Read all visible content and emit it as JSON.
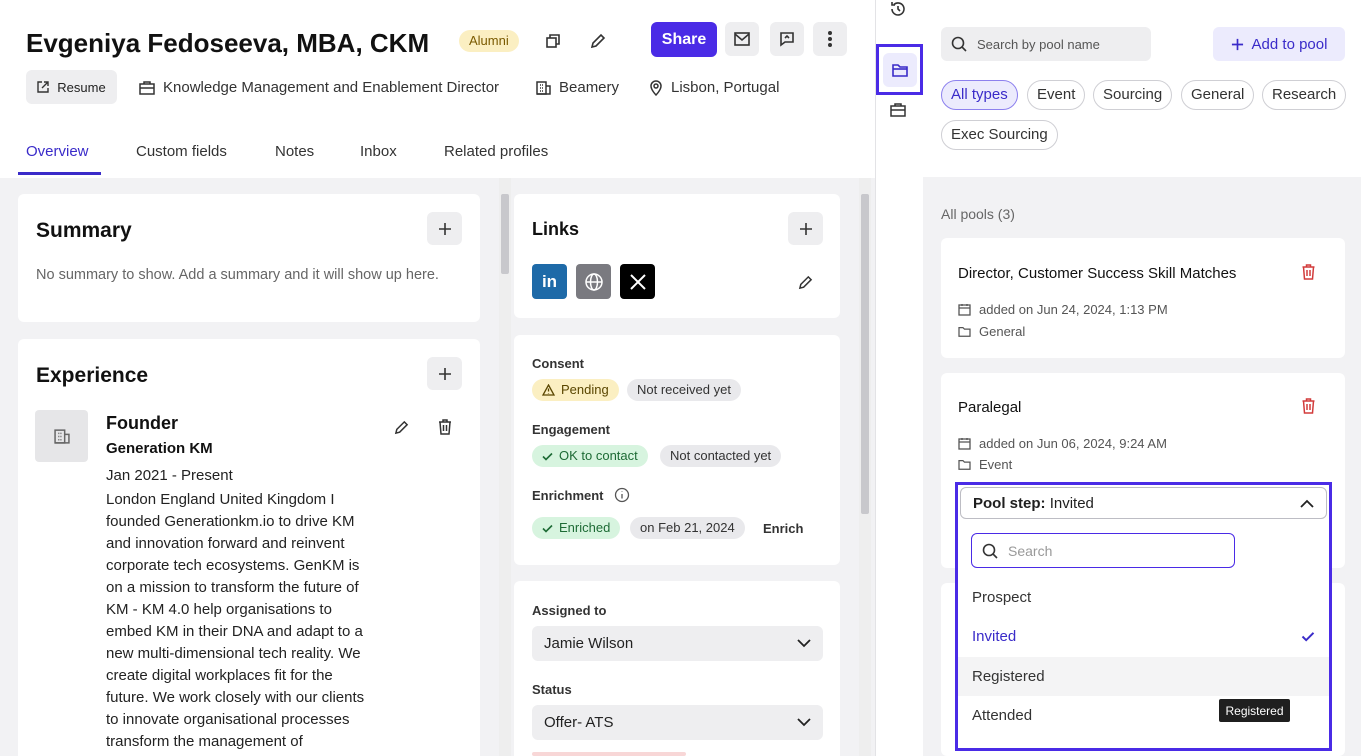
{
  "header": {
    "name": "Evgeniya Fedoseeva, MBA, CKM",
    "badge": "Alumni",
    "share_label": "Share",
    "resume_label": "Resume",
    "job_title": "Knowledge Management and Enablement Director",
    "company": "Beamery",
    "location": "Lisbon, Portugal"
  },
  "tabs": [
    {
      "label": "Overview",
      "active": true
    },
    {
      "label": "Custom fields"
    },
    {
      "label": "Notes"
    },
    {
      "label": "Inbox"
    },
    {
      "label": "Related profiles"
    }
  ],
  "summary": {
    "title": "Summary",
    "empty_text": "No summary to show. Add a summary and it will show up here."
  },
  "experience": {
    "title": "Experience",
    "role": "Founder",
    "company": "Generation KM",
    "dates": "Jan 2021 - Present",
    "description": "London England United Kingdom I founded Generationkm.io to drive KM and innovation forward and reinvent corporate tech ecosystems. GenKM is on a mission to transform the future of KM - KM 4.0 help organisations to embed KM in their DNA and adapt to a new multi-dimensional tech reality. We create digital workplaces fit for the future. We work closely with our clients to innovate organisational processes transform the management of"
  },
  "links": {
    "title": "Links",
    "items": [
      "in"
    ]
  },
  "status_card": {
    "consent_label": "Consent",
    "consent_chips": [
      "Pending",
      "Not received yet"
    ],
    "engagement_label": "Engagement",
    "engagement_chips": [
      "OK to contact",
      "Not contacted yet"
    ],
    "enrichment_label": "Enrichment",
    "enrichment_chips": [
      "Enriched",
      "on Feb 21, 2024"
    ],
    "enrich_action": "Enrich"
  },
  "assignment": {
    "assigned_label": "Assigned to",
    "assigned_value": "Jamie Wilson",
    "status_label": "Status",
    "status_value": "Offer- ATS"
  },
  "pools_panel": {
    "search_placeholder": "Search by pool name",
    "add_label": "Add to pool",
    "filters": [
      "All types",
      "Event",
      "Sourcing",
      "General",
      "Research",
      "Exec Sourcing"
    ],
    "count_label": "All pools (3)",
    "pools": [
      {
        "title": "Director, Customer Success Skill Matches",
        "added": "added on Jun 24, 2024, 1:13 PM",
        "type": "General"
      },
      {
        "title": "Paralegal",
        "added": "added on Jun 06, 2024, 9:24 AM",
        "type": "Event"
      }
    ],
    "pool_step": {
      "label": "Pool step:",
      "value": "Invited",
      "search_placeholder": "Search",
      "options": [
        "Prospect",
        "Invited",
        "Registered",
        "Attended"
      ],
      "tooltip": "Registered"
    }
  },
  "colors": {
    "accent": "#4a2be6",
    "alumni_bg": "#fbefc2",
    "success_bg": "#d7f4df",
    "danger": "#d23b3b",
    "linkedin": "#0a66c2"
  }
}
